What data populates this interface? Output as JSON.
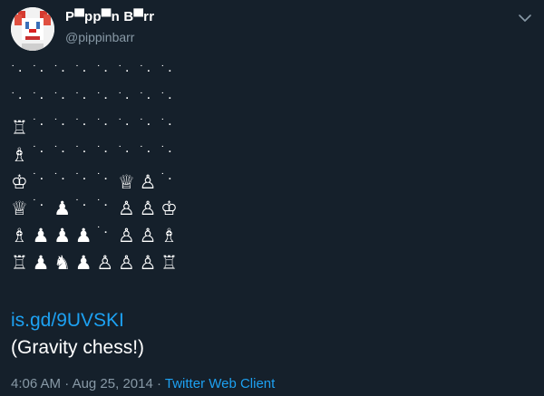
{
  "tweet": {
    "display_name": "P▀pp▀n B▀rr",
    "handle": "@pippinbarr",
    "link_text": "is.gd/9UVSKI",
    "body_text": "(Gravity chess!)",
    "time": "4:06 AM",
    "separator": "·",
    "date": "Aug 25, 2014",
    "source": "Twitter Web Client"
  },
  "board": {
    "rows": [
      [
        "˙.",
        "˙.",
        "˙.",
        "˙.",
        "˙.",
        "˙.",
        "˙.",
        "˙."
      ],
      [
        "˙.",
        "˙.",
        "˙.",
        "˙.",
        "˙.",
        "˙.",
        "˙.",
        "˙."
      ],
      [
        "♖",
        "˙.",
        "˙.",
        "˙.",
        "˙.",
        "˙.",
        "˙.",
        "˙."
      ],
      [
        "♗",
        "˙.",
        "˙.",
        "˙.",
        "˙.",
        "˙.",
        "˙.",
        "˙."
      ],
      [
        "♔",
        "˙.",
        "˙.",
        "˙.",
        "˙.",
        "♕",
        "♙",
        "˙."
      ],
      [
        "♕",
        "˙.",
        "♟",
        "˙.",
        "˙.",
        "♙",
        "♙",
        "♔"
      ],
      [
        "♗",
        "♟",
        "♟",
        "♟",
        "˙.",
        "♙",
        "♙",
        "♗"
      ],
      [
        "♖",
        "♟",
        "♞",
        "♟",
        "♙",
        "♙",
        "♙",
        "♖"
      ]
    ]
  },
  "colors": {
    "background": "#15202b",
    "text": "#ffffff",
    "muted": "#8899a6",
    "link": "#1da1f2"
  },
  "icons": {
    "avatar": "clown-face-avatar",
    "menu": "chevron-down-icon"
  }
}
